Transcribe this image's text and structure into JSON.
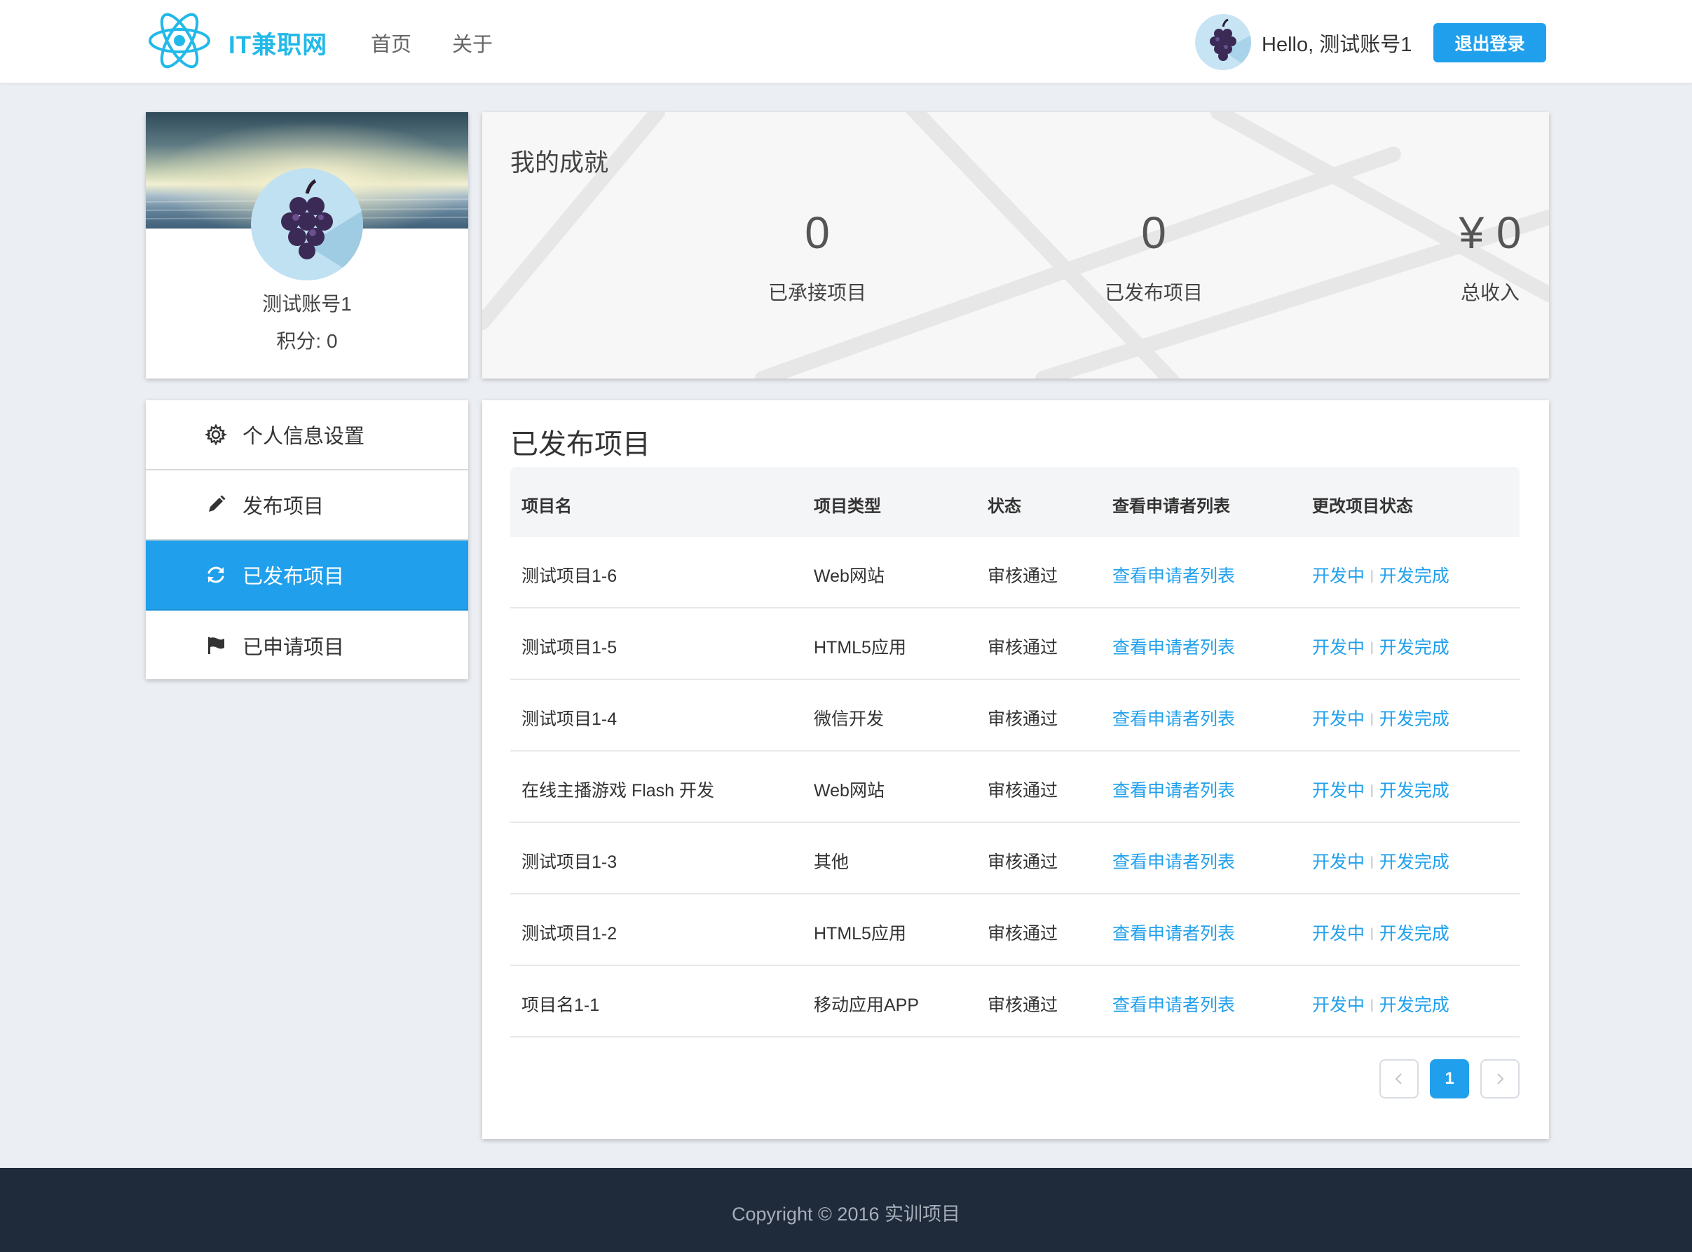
{
  "header": {
    "brand": "IT兼职网",
    "nav": {
      "home": "首页",
      "about": "关于"
    },
    "greeting": "Hello, 测试账号1",
    "logout_label": "退出登录",
    "accent_color": "#20a0ec"
  },
  "profile": {
    "name": "测试账号1",
    "points": "积分: 0"
  },
  "achievements": {
    "title": "我的成就",
    "stats": [
      {
        "value": "0",
        "label": "已承接项目"
      },
      {
        "value": "0",
        "label": "已发布项目"
      },
      {
        "value": "¥ 0",
        "label": "总收入"
      }
    ]
  },
  "menu": {
    "items": [
      {
        "label": "个人信息设置",
        "icon": "gear-icon",
        "active": false
      },
      {
        "label": "发布项目",
        "icon": "pencil-icon",
        "active": false
      },
      {
        "label": "已发布项目",
        "icon": "refresh-icon",
        "active": true
      },
      {
        "label": "已申请项目",
        "icon": "flag-icon",
        "active": false
      }
    ]
  },
  "projects": {
    "title": "已发布项目",
    "columns": [
      "项目名",
      "项目类型",
      "状态",
      "查看申请者列表",
      "更改项目状态"
    ],
    "rows": [
      {
        "name": "测试项目1-6",
        "type": "Web网站",
        "status": "审核通过",
        "view": "查看申请者列表",
        "action_a": "开发中",
        "action_b": "开发完成"
      },
      {
        "name": "测试项目1-5",
        "type": "HTML5应用",
        "status": "审核通过",
        "view": "查看申请者列表",
        "action_a": "开发中",
        "action_b": "开发完成"
      },
      {
        "name": "测试项目1-4",
        "type": "微信开发",
        "status": "审核通过",
        "view": "查看申请者列表",
        "action_a": "开发中",
        "action_b": "开发完成"
      },
      {
        "name": "在线主播游戏 Flash 开发",
        "type": "Web网站",
        "status": "审核通过",
        "view": "查看申请者列表",
        "action_a": "开发中",
        "action_b": "开发完成"
      },
      {
        "name": "测试项目1-3",
        "type": "其他",
        "status": "审核通过",
        "view": "查看申请者列表",
        "action_a": "开发中",
        "action_b": "开发完成"
      },
      {
        "name": "测试项目1-2",
        "type": "HTML5应用",
        "status": "审核通过",
        "view": "查看申请者列表",
        "action_a": "开发中",
        "action_b": "开发完成"
      },
      {
        "name": "项目名1-1",
        "type": "移动应用APP",
        "status": "审核通过",
        "view": "查看申请者列表",
        "action_a": "开发中",
        "action_b": "开发完成"
      }
    ],
    "separator": "|",
    "pagination": {
      "current_page": "1"
    }
  },
  "footer": {
    "copyright": "Copyright © 2016 实训项目"
  }
}
